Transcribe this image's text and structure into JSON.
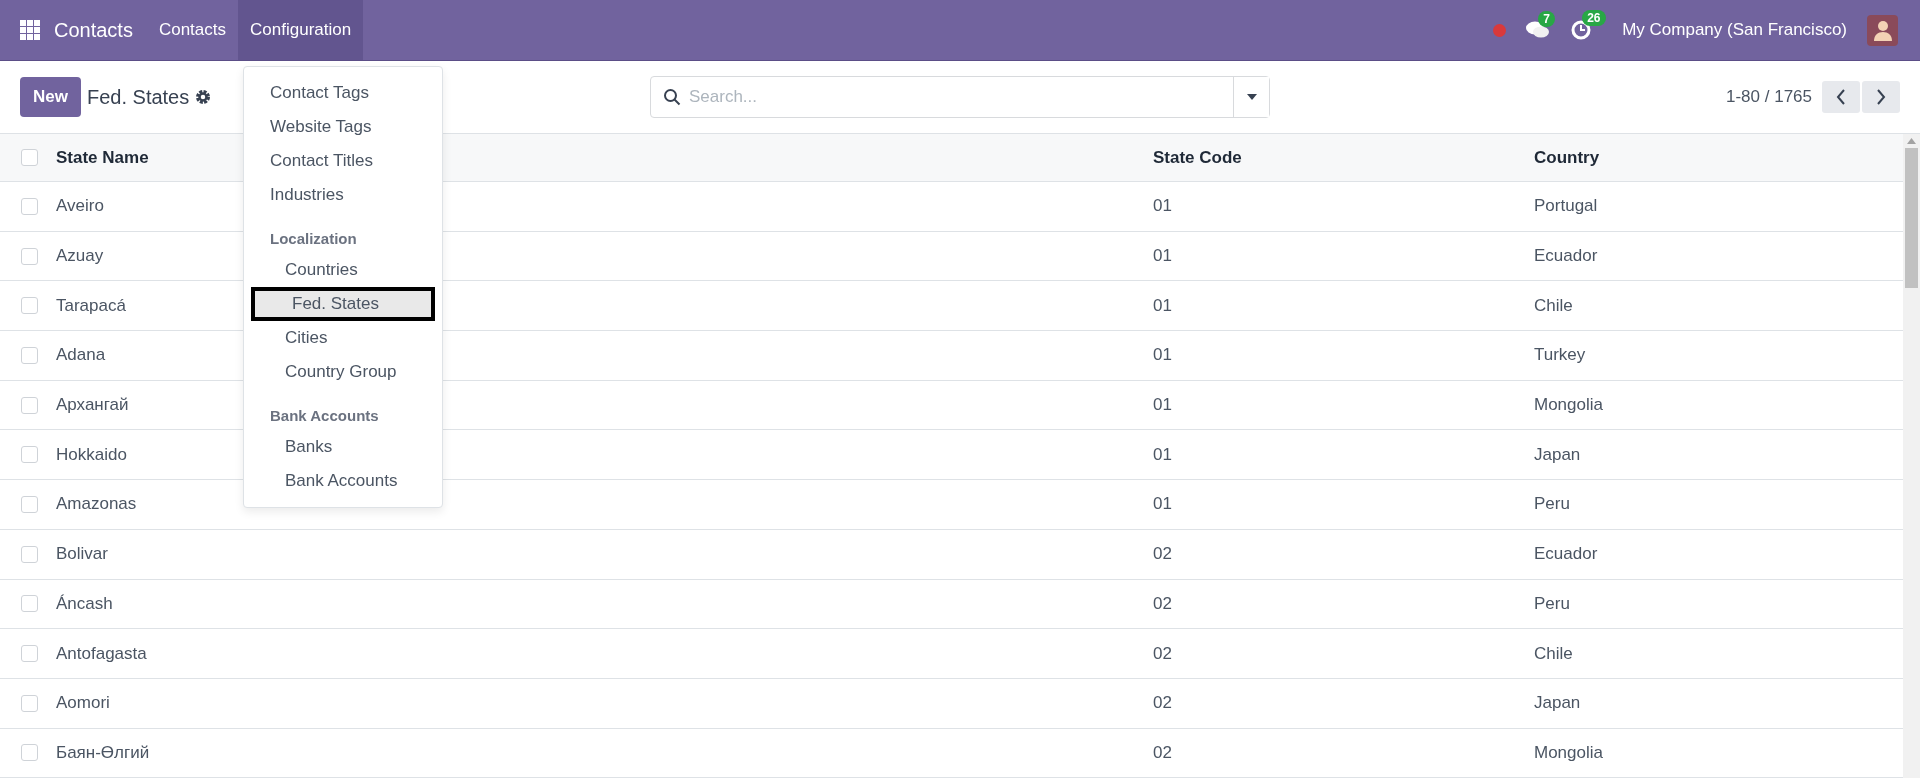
{
  "navbar": {
    "app_name": "Contacts",
    "menus": [
      {
        "label": "Contacts",
        "selected": false
      },
      {
        "label": "Configuration",
        "selected": true
      }
    ],
    "chat_count": "7",
    "activity_count": "26",
    "company": "My Company (San Francisco)"
  },
  "control_panel": {
    "new_button": "New",
    "breadcrumb": "Fed. States",
    "search": {
      "placeholder": "Search..."
    },
    "pager": "1-80 / 1765"
  },
  "dropdown": [
    {
      "kind": "item",
      "label": "Contact Tags",
      "selected": false
    },
    {
      "kind": "item",
      "label": "Website Tags",
      "selected": false
    },
    {
      "kind": "item",
      "label": "Contact Titles",
      "selected": false
    },
    {
      "kind": "item",
      "label": "Industries",
      "selected": false
    },
    {
      "kind": "section",
      "label": "Localization"
    },
    {
      "kind": "subitem",
      "label": "Countries",
      "selected": false
    },
    {
      "kind": "subitem",
      "label": "Fed. States",
      "selected": true
    },
    {
      "kind": "subitem",
      "label": "Cities",
      "selected": false
    },
    {
      "kind": "subitem",
      "label": "Country Group",
      "selected": false
    },
    {
      "kind": "section",
      "label": "Bank Accounts"
    },
    {
      "kind": "subitem",
      "label": "Banks",
      "selected": false
    },
    {
      "kind": "subitem",
      "label": "Bank Accounts",
      "selected": false
    }
  ],
  "table": {
    "select_all_checked": false,
    "row_checked": [
      false,
      false,
      false,
      false,
      false,
      false,
      false,
      false,
      false,
      false,
      false,
      false
    ],
    "columns": [
      "State Name",
      "State Code",
      "Country"
    ],
    "rows": [
      [
        "Aveiro",
        "01",
        "Portugal"
      ],
      [
        "Azuay",
        "01",
        "Ecuador"
      ],
      [
        "Tarapacá",
        "01",
        "Chile"
      ],
      [
        "Adana",
        "01",
        "Turkey"
      ],
      [
        "Архангай",
        "01",
        "Mongolia"
      ],
      [
        "Hokkaido",
        "01",
        "Japan"
      ],
      [
        "Amazonas",
        "01",
        "Peru"
      ],
      [
        "Bolivar",
        "02",
        "Ecuador"
      ],
      [
        "Áncash",
        "02",
        "Peru"
      ],
      [
        "Antofagasta",
        "02",
        "Chile"
      ],
      [
        "Aomori",
        "02",
        "Japan"
      ],
      [
        "Баян-Өлгий",
        "02",
        "Mongolia"
      ]
    ]
  }
}
